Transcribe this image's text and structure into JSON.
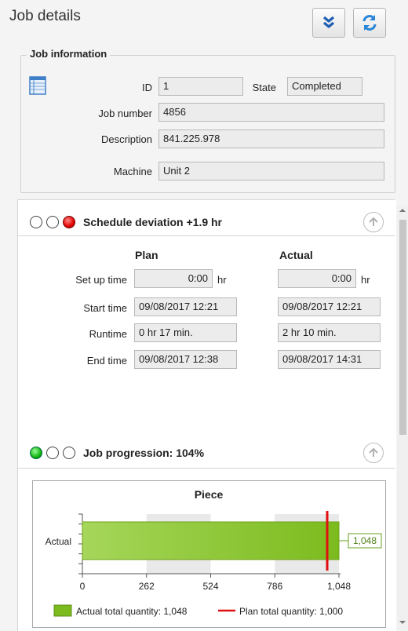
{
  "header": {
    "title": "Job details",
    "expand_icon": "double-chevron-down-icon",
    "refresh_icon": "refresh-arrows-icon"
  },
  "job_info": {
    "legend": "Job information",
    "icon": "table-grid-icon",
    "id_label": "ID",
    "id_value": "1",
    "state_label": "State",
    "state_value": "Completed",
    "job_number_label": "Job number",
    "job_number_value": "4856",
    "description_label": "Description",
    "description_value": "841.225.978",
    "machine_label": "Machine",
    "machine_value": "Unit 2"
  },
  "schedule": {
    "title": "Schedule deviation +1.9 hr",
    "traffic_light": [
      "off",
      "off",
      "red"
    ],
    "plan_header": "Plan",
    "actual_header": "Actual",
    "rows": [
      {
        "label": "Set up time",
        "plan": "0:00",
        "actual": "0:00",
        "unit": "hr"
      },
      {
        "label": "Start time",
        "plan": "09/08/2017 12:21",
        "actual": "09/08/2017 12:21",
        "unit": ""
      },
      {
        "label": "Runtime",
        "plan": "0 hr 17 min.",
        "actual": "2 hr 10 min.",
        "unit": ""
      },
      {
        "label": "End time",
        "plan": "09/08/2017 12:38",
        "actual": "09/08/2017 14:31",
        "unit": ""
      }
    ]
  },
  "progression": {
    "title": "Job progression: 104%",
    "traffic_light": [
      "green",
      "off",
      "off"
    ]
  },
  "colors": {
    "bar_fill": "#7cbb1e",
    "plan_line": "#e01010",
    "label_border": "#6aa21f",
    "label_text": "#4e7f16"
  },
  "chart_data": {
    "type": "bar",
    "orientation": "horizontal",
    "title": "Piece",
    "categories": [
      "Actual"
    ],
    "series": [
      {
        "name": "Actual total quantity: 1,048",
        "values": [
          1048
        ]
      }
    ],
    "data_labels": [
      "1,048"
    ],
    "plan_line": {
      "name": "Plan total quantity: 1,000",
      "value": 1000
    },
    "xlim": [
      0,
      1048
    ],
    "x_ticks": [
      0,
      262,
      524,
      786,
      1048
    ],
    "x_tick_labels": [
      "0",
      "262",
      "524",
      "786",
      "1,048"
    ],
    "grid": "alternating bands",
    "legend_position": "bottom"
  }
}
